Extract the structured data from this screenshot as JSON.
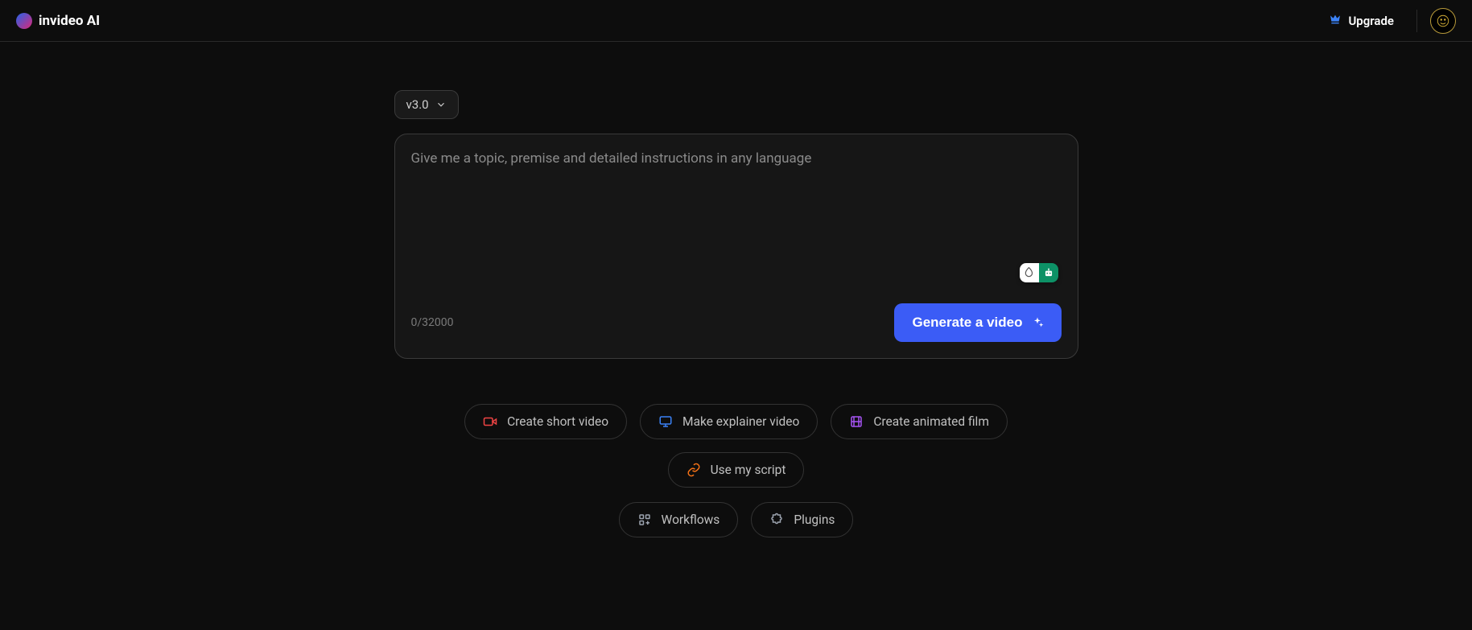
{
  "header": {
    "brand": "invideo AI",
    "upgrade_label": "Upgrade"
  },
  "version": {
    "selected": "v3.0"
  },
  "prompt": {
    "placeholder": "Give me a topic, premise and detailed instructions in any language",
    "char_count": "0/32000"
  },
  "actions": {
    "generate_label": "Generate a video"
  },
  "chips": [
    {
      "label": "Create short video",
      "icon": "video-icon",
      "color": "red"
    },
    {
      "label": "Make explainer video",
      "icon": "screen-icon",
      "color": "blue"
    },
    {
      "label": "Create animated film",
      "icon": "film-icon",
      "color": "purple"
    },
    {
      "label": "Use my script",
      "icon": "link-icon",
      "color": "orange"
    }
  ],
  "secondary_chips": [
    {
      "label": "Workflows",
      "icon": "workflow-icon",
      "color": "gray"
    },
    {
      "label": "Plugins",
      "icon": "puzzle-icon",
      "color": "gray"
    }
  ]
}
